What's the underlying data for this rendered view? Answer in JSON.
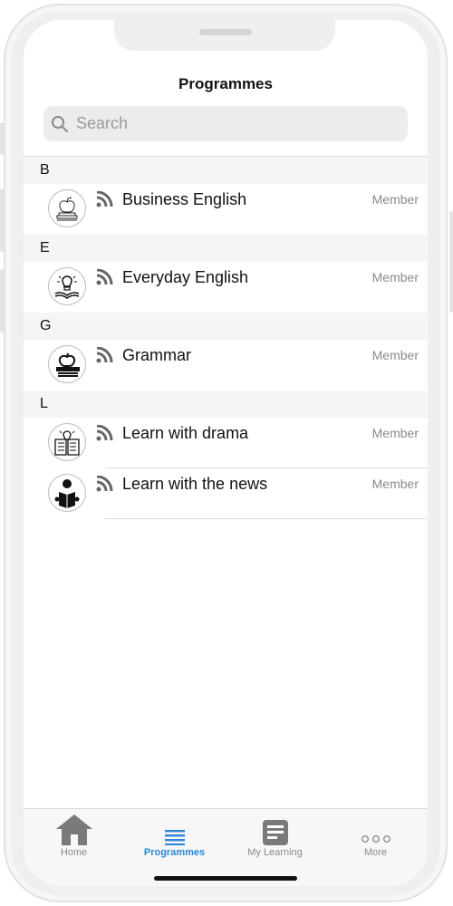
{
  "header": {
    "title": "Programmes"
  },
  "search": {
    "placeholder": "Search",
    "value": ""
  },
  "sections": [
    {
      "letter": "B",
      "items": [
        {
          "name": "Business English",
          "badge": "Member",
          "icon": "apple-books-outline-icon"
        }
      ]
    },
    {
      "letter": "E",
      "items": [
        {
          "name": "Everyday English",
          "badge": "Member",
          "icon": "lightbulb-book-icon"
        }
      ]
    },
    {
      "letter": "G",
      "items": [
        {
          "name": "Grammar",
          "badge": "Member",
          "icon": "apple-books-solid-icon"
        }
      ]
    },
    {
      "letter": "L",
      "items": [
        {
          "name": "Learn with drama",
          "badge": "Member",
          "icon": "lightbulb-open-book-icon"
        },
        {
          "name": "Learn with the news",
          "badge": "Member",
          "icon": "person-reading-icon"
        }
      ]
    }
  ],
  "tabbar": {
    "tabs": [
      {
        "label": "Home",
        "icon": "home-icon",
        "active": false
      },
      {
        "label": "Programmes",
        "icon": "list-icon",
        "active": true
      },
      {
        "label": "My Learning",
        "icon": "document-icon",
        "active": false
      },
      {
        "label": "More",
        "icon": "more-dots-icon",
        "active": false
      }
    ]
  },
  "colors": {
    "accent": "#2a85d8",
    "inactive": "#8a8a8a",
    "section_bg": "#f5f5f5"
  }
}
